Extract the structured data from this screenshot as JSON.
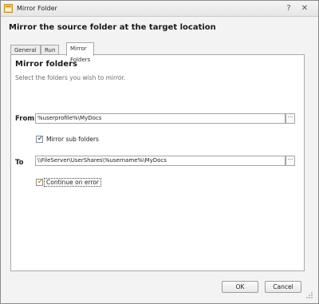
{
  "window": {
    "title": "Mirror Folder",
    "help_glyph": "?",
    "close_glyph": "✕"
  },
  "heading": "Mirror the source folder at the target location",
  "tabs": [
    {
      "label": "General"
    },
    {
      "label": "Run As"
    },
    {
      "label": "Mirror Folders"
    }
  ],
  "panel": {
    "title": "Mirror folders",
    "subtitle": "Select the folders you wish to mirror.",
    "from": {
      "label": "From",
      "value": "%userprofile%\\MyDocs",
      "browse_label": "···"
    },
    "mirror_sub": {
      "label": "Mirror sub folders",
      "checked": true,
      "check_glyph": "✔"
    },
    "to": {
      "label": "To",
      "value": "\\\\FileServer\\UserShares\\%username%\\MyDocs",
      "browse_label": "···"
    },
    "continue_on_error": {
      "label": "Continue on error",
      "checked": true,
      "check_glyph": "✔"
    }
  },
  "buttons": {
    "ok": "OK",
    "cancel": "Cancel"
  },
  "colors": {
    "check_mark_primary": "#3a6ea5",
    "check_mark_focused": "#d98b1a"
  }
}
